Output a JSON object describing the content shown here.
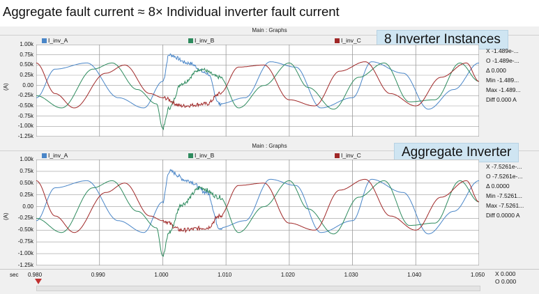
{
  "slide_title": "Aggregate fault current ≈ 8× Individual inverter fault current",
  "colors": {
    "phase_a": "#4a86c8",
    "phase_b": "#2e8b5e",
    "phase_c": "#a02828",
    "grid": "#9a9a9a",
    "plot_bg": "#ffffff",
    "callout_bg": "#cfe5f2"
  },
  "graphs": [
    {
      "panel_title": "Main : Graphs",
      "callout": "8 Inverter Instances",
      "legend": [
        "I_inv_A",
        "I_inv_B",
        "I_inv_C"
      ],
      "ylabel": "(A)",
      "yticks": [
        "1.00k",
        "0.75k",
        "0.50k",
        "0.25k",
        "0.00",
        "-0.25k",
        "-0.50k",
        "-0.75k",
        "-1.00k",
        "-1.25k"
      ],
      "readouts": [
        "X -1.489e-...",
        "O -1.489e-...",
        "Δ 0.000",
        "Min -1.489...",
        "Max -1.489...",
        "Diff 0.000 A"
      ]
    },
    {
      "panel_title": "Main : Graphs",
      "callout": "Aggregate Inverter",
      "legend": [
        "I_inv_A",
        "I_inv_B",
        "I_inv_C"
      ],
      "ylabel": "(A)",
      "yticks": [
        "1.00k",
        "0.75k",
        "0.50k",
        "0.25k",
        "0.00",
        "-0.25k",
        "-0.50k",
        "-0.75k",
        "-1.00k",
        "-1.25k"
      ],
      "readouts": [
        "X -7.5261e-...",
        "O -7.5261e-...",
        "Δ 0.0000",
        "Min -7.5261...",
        "Max -7.5261...",
        "Diff 0.0000 A"
      ]
    }
  ],
  "xaxis": {
    "unit_label": "sec",
    "ticks": [
      "0.980",
      "0.990",
      "1.000",
      "1.010",
      "1.020",
      "1.030",
      "1.040",
      "1.050"
    ],
    "readouts": [
      "X 0.000",
      "O 0.000"
    ]
  },
  "chart_data": [
    {
      "type": "line",
      "title": "Main : Graphs",
      "ylabel": "(A)",
      "xlim": [
        0.98,
        1.05
      ],
      "ylim": [
        -1.25,
        1.0
      ],
      "y_unit": "kA",
      "grid": true,
      "legend_position": "top",
      "description_of_waveform": "three-phase sinusoidal currents, amplitude ≈0.6 kA, frequency 60 Hz; fault transient at t=1.000 s lasting until ≈1.009 s",
      "series": [
        {
          "name": "I_inv_A",
          "points": [
            [
              0.98,
              -0.3
            ],
            [
              0.983,
              0.4
            ],
            [
              0.988,
              0.55
            ],
            [
              0.993,
              -0.3
            ],
            [
              0.997,
              -0.55
            ],
            [
              1.0,
              0.1
            ],
            [
              1.001,
              0.75
            ],
            [
              1.004,
              0.55
            ],
            [
              1.007,
              0.3
            ],
            [
              1.009,
              -0.45
            ],
            [
              1.013,
              -0.3
            ],
            [
              1.017,
              0.58
            ],
            [
              1.021,
              0.45
            ],
            [
              1.025,
              -0.55
            ],
            [
              1.03,
              -0.3
            ],
            [
              1.033,
              0.58
            ],
            [
              1.038,
              0.3
            ],
            [
              1.042,
              -0.58
            ],
            [
              1.046,
              -0.1
            ],
            [
              1.05,
              0.55
            ]
          ]
        },
        {
          "name": "I_inv_B",
          "points": [
            [
              0.98,
              -0.25
            ],
            [
              0.984,
              -0.55
            ],
            [
              0.989,
              0.4
            ],
            [
              0.992,
              0.55
            ],
            [
              0.996,
              -0.1
            ],
            [
              0.999,
              -0.45
            ],
            [
              1.0,
              -1.05
            ],
            [
              1.001,
              -0.55
            ],
            [
              1.003,
              0.05
            ],
            [
              1.006,
              0.4
            ],
            [
              1.009,
              0.2
            ],
            [
              1.012,
              -0.55
            ],
            [
              1.016,
              0.0
            ],
            [
              1.02,
              0.55
            ],
            [
              1.023,
              -0.05
            ],
            [
              1.027,
              -0.58
            ],
            [
              1.031,
              0.2
            ],
            [
              1.035,
              0.55
            ],
            [
              1.039,
              -0.4
            ],
            [
              1.043,
              -0.35
            ],
            [
              1.047,
              0.55
            ],
            [
              1.05,
              0.1
            ]
          ]
        },
        {
          "name": "I_inv_C",
          "points": [
            [
              0.98,
              0.55
            ],
            [
              0.983,
              -0.2
            ],
            [
              0.986,
              -0.55
            ],
            [
              0.991,
              0.3
            ],
            [
              0.994,
              0.5
            ],
            [
              0.998,
              -0.2
            ],
            [
              1.0,
              -0.3
            ],
            [
              1.003,
              -0.5
            ],
            [
              1.007,
              -0.45
            ],
            [
              1.009,
              -0.2
            ],
            [
              1.012,
              0.45
            ],
            [
              1.016,
              0.5
            ],
            [
              1.02,
              -0.35
            ],
            [
              1.024,
              -0.5
            ],
            [
              1.028,
              0.35
            ],
            [
              1.032,
              0.58
            ],
            [
              1.036,
              -0.2
            ],
            [
              1.04,
              -0.5
            ],
            [
              1.044,
              0.2
            ],
            [
              1.048,
              0.55
            ],
            [
              1.05,
              0.1
            ]
          ]
        }
      ]
    },
    {
      "type": "line",
      "title": "Main : Graphs",
      "ylabel": "(A)",
      "xlim": [
        0.98,
        1.05
      ],
      "ylim": [
        -1.25,
        1.0
      ],
      "y_unit": "kA",
      "grid": true,
      "legend_position": "top",
      "series": [
        {
          "name": "I_inv_A",
          "points": [
            [
              0.98,
              -0.3
            ],
            [
              0.983,
              0.4
            ],
            [
              0.988,
              0.55
            ],
            [
              0.993,
              -0.3
            ],
            [
              0.997,
              -0.55
            ],
            [
              1.0,
              0.1
            ],
            [
              1.001,
              0.75
            ],
            [
              1.004,
              0.55
            ],
            [
              1.007,
              0.3
            ],
            [
              1.009,
              -0.45
            ],
            [
              1.013,
              -0.3
            ],
            [
              1.017,
              0.58
            ],
            [
              1.021,
              0.45
            ],
            [
              1.025,
              -0.55
            ],
            [
              1.03,
              -0.3
            ],
            [
              1.033,
              0.58
            ],
            [
              1.038,
              0.3
            ],
            [
              1.042,
              -0.58
            ],
            [
              1.046,
              -0.1
            ],
            [
              1.05,
              0.55
            ]
          ]
        },
        {
          "name": "I_inv_B",
          "points": [
            [
              0.98,
              -0.25
            ],
            [
              0.984,
              -0.55
            ],
            [
              0.989,
              0.4
            ],
            [
              0.992,
              0.55
            ],
            [
              0.996,
              -0.1
            ],
            [
              0.999,
              -0.45
            ],
            [
              1.0,
              -1.05
            ],
            [
              1.001,
              -0.55
            ],
            [
              1.003,
              0.05
            ],
            [
              1.006,
              0.4
            ],
            [
              1.009,
              0.2
            ],
            [
              1.012,
              -0.55
            ],
            [
              1.016,
              0.0
            ],
            [
              1.02,
              0.55
            ],
            [
              1.023,
              -0.05
            ],
            [
              1.027,
              -0.58
            ],
            [
              1.031,
              0.2
            ],
            [
              1.035,
              0.55
            ],
            [
              1.039,
              -0.4
            ],
            [
              1.043,
              -0.35
            ],
            [
              1.047,
              0.55
            ],
            [
              1.05,
              0.1
            ]
          ]
        },
        {
          "name": "I_inv_C",
          "points": [
            [
              0.98,
              0.55
            ],
            [
              0.983,
              -0.2
            ],
            [
              0.986,
              -0.55
            ],
            [
              0.991,
              0.3
            ],
            [
              0.994,
              0.5
            ],
            [
              0.998,
              -0.2
            ],
            [
              1.0,
              -0.3
            ],
            [
              1.003,
              -0.5
            ],
            [
              1.007,
              -0.45
            ],
            [
              1.009,
              -0.2
            ],
            [
              1.012,
              0.45
            ],
            [
              1.016,
              0.5
            ],
            [
              1.02,
              -0.35
            ],
            [
              1.024,
              -0.5
            ],
            [
              1.028,
              0.35
            ],
            [
              1.032,
              0.58
            ],
            [
              1.036,
              -0.2
            ],
            [
              1.04,
              -0.5
            ],
            [
              1.044,
              0.2
            ],
            [
              1.048,
              0.55
            ],
            [
              1.05,
              0.1
            ]
          ]
        }
      ]
    }
  ]
}
